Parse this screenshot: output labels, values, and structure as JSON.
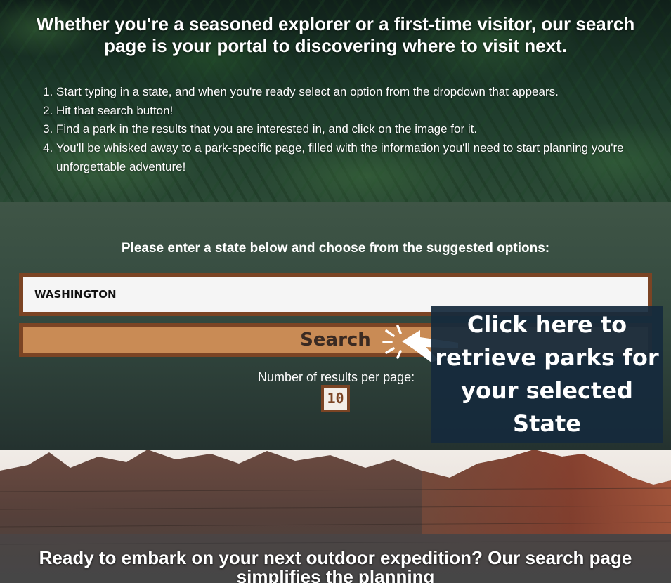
{
  "hero": {
    "title": "Whether you're a seasoned explorer or a first-time visitor, our search page is your portal to discovering where to visit next.",
    "steps": [
      "Start typing in a state, and when you're ready select an option from the dropdown that appears.",
      "Hit that search button!",
      "Find a park in the results that you are interested in, and click on the image for it.",
      "You'll be whisked away to a park-specific page, filled with the information you'll need to start planning you're unforgettable adventure!"
    ]
  },
  "search": {
    "prompt": "Please enter a state below and choose from the suggested options:",
    "input_value": "WASHINGTON",
    "button_label": "Search",
    "results_label": "Number of results per page:",
    "results_value": "10"
  },
  "tooltip": {
    "text": "Click here to retrieve parks for your selected State",
    "pointer_icon": "hand-pointer-icon"
  },
  "bottom": {
    "title": "Ready to embark on your next outdoor expedition? Our search page simplifies the planning"
  },
  "colors": {
    "accent_border": "#7b4424",
    "button_fill": "#c98b55",
    "tooltip_bg": "#152a3c"
  }
}
